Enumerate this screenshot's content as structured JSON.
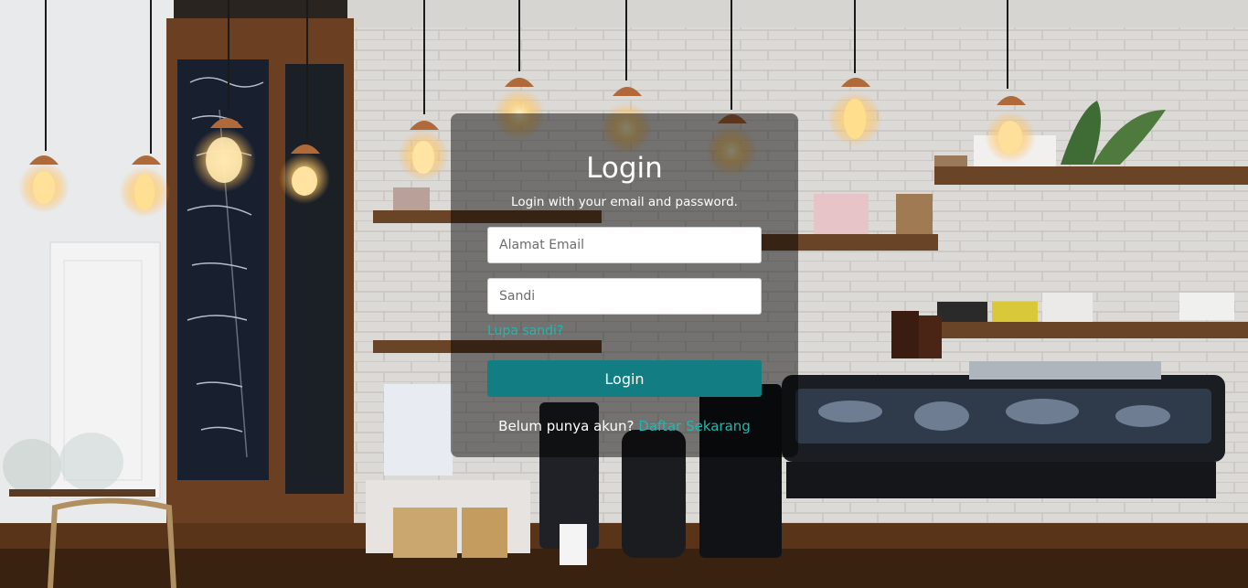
{
  "login": {
    "title": "Login",
    "subtitle": "Login with your email and password.",
    "email_placeholder": "Alamat Email",
    "password_placeholder": "Sandi",
    "forgot_label": "Lupa sandi?",
    "login_button_label": "Login",
    "register_prompt": "Belum punya akun?",
    "register_link_label": "Daftar Sekarang"
  },
  "colors": {
    "accent": "#1fb8b0",
    "button": "#127e84",
    "card_overlay": "rgba(0,0,0,0.48)"
  }
}
